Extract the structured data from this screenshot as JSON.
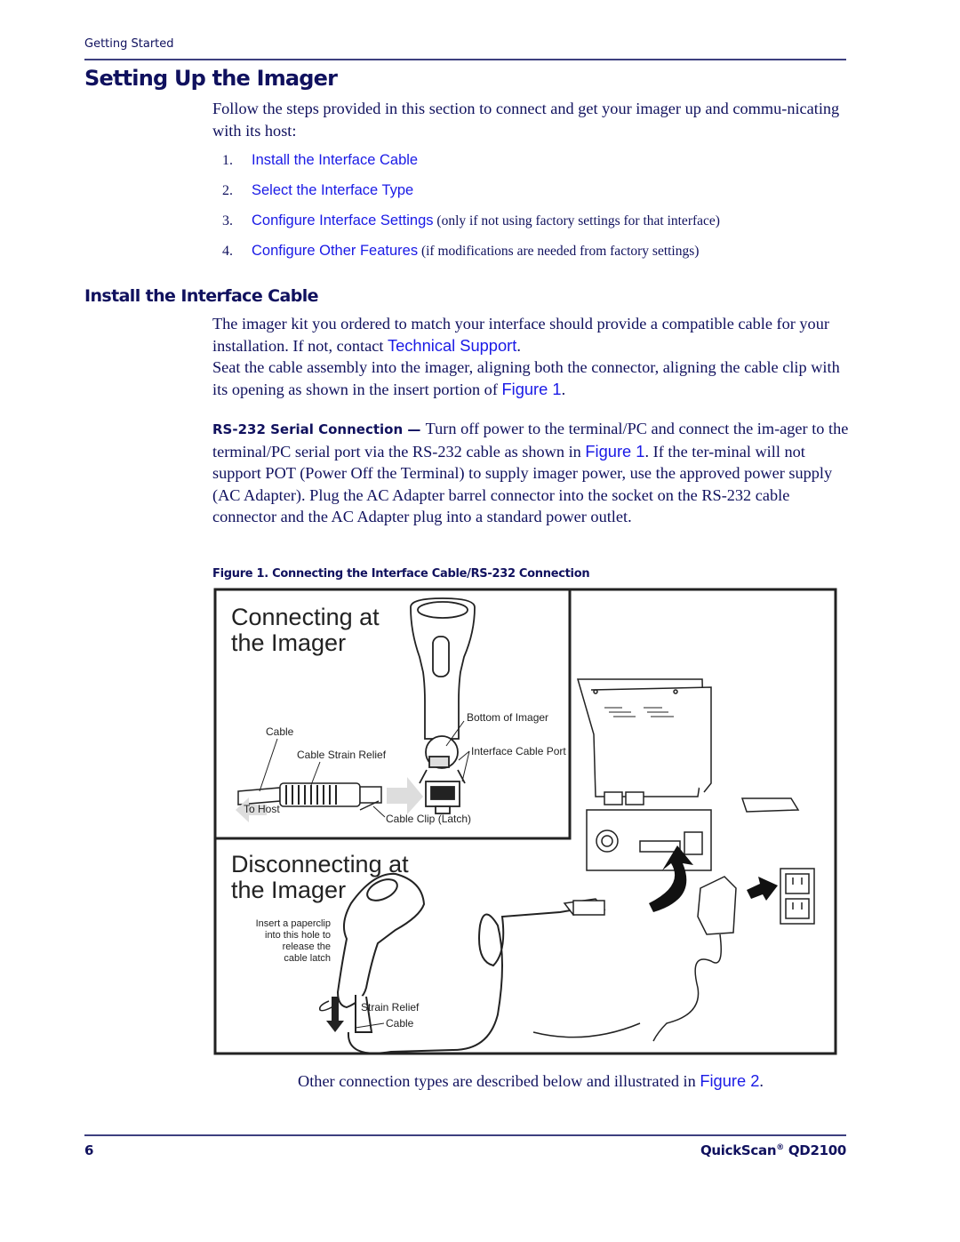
{
  "header": {
    "running_head": "Getting Started"
  },
  "section": {
    "title": "Setting Up the Imager",
    "intro": "Follow the steps provided in this section to connect and get your imager up and commu-nicating with its host:",
    "steps": [
      {
        "number": "1.",
        "link": "Install the Interface Cable",
        "note": ""
      },
      {
        "number": "2.",
        "link": "Select the Interface Type",
        "note": ""
      },
      {
        "number": "3.",
        "link": "Configure Interface Settings",
        "note": " (only if not using factory settings for that interface)"
      },
      {
        "number": "4.",
        "link": "Configure Other Features",
        "note": " (if modifications are needed from factory settings)"
      }
    ]
  },
  "subsection": {
    "title": "Install the Interface Cable",
    "para1_prefix": "The imager kit you ordered to match your interface should provide a compatible cable for your installation. If not, contact ",
    "para1_link": "Technical Support",
    "para1_suffix": ".",
    "para2_prefix": "Seat the cable assembly into the imager, aligning both the connector, aligning the cable clip with its opening as shown in the insert portion of ",
    "para2_link": "Figure 1",
    "para2_suffix": ".",
    "rs232_label": "RS-232 Serial Connection",
    "rs232_dash": " — ",
    "rs232_prefix": "Turn off power to the terminal/PC and connect the im-ager to the terminal/PC serial port via the RS-232 cable as shown in ",
    "rs232_link": "Figure 1",
    "rs232_suffix": ". If the ter-minal will not support POT (Power Off the Terminal) to supply imager power, use the approved power supply (AC Adapter). Plug the AC Adapter barrel connector into the socket on the RS-232 cable connector and the AC Adapter plug into a standard power outlet."
  },
  "figure": {
    "caption": "Figure 1. Connecting the Interface Cable/RS-232 Connection",
    "connecting_title_1": "Connecting at",
    "connecting_title_2": "the Imager",
    "disconnecting_title_1": "Disconnecting at",
    "disconnecting_title_2": "the Imager",
    "labels": {
      "bottom_of_imager": "Bottom of Imager",
      "cable": "Cable",
      "cable_strain_relief": "Cable Strain Relief",
      "interface_cable_port": "Interface Cable Port",
      "to_host": "To Host",
      "cable_clip": "Cable Clip (Latch)",
      "paperclip_1": "Insert a paperclip",
      "paperclip_2": "into this hole to",
      "paperclip_3": "release the",
      "paperclip_4": "cable latch",
      "strain_relief": "Strain Relief",
      "cable_bottom": "Cable"
    }
  },
  "closing": {
    "prefix": "Other connection types are described below and illustrated in ",
    "link": "Figure 2",
    "suffix": "."
  },
  "footer": {
    "page_number": "6",
    "product": "QuickScan",
    "registered": "®",
    "model": " QD2100"
  },
  "colors": {
    "heading": "#10115e",
    "link": "#1a1ae6",
    "rule": "#3d3f7f"
  }
}
